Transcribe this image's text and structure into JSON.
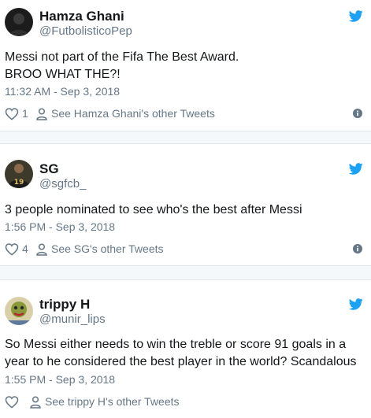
{
  "colors": {
    "twitter_blue": "#1da1f2",
    "muted": "#657786",
    "text": "#14171a",
    "divider": "#e1e8ed"
  },
  "tweets": [
    {
      "name": "Hamza Ghani",
      "handle": "@FutbolisticoPep",
      "text_lines": [
        "Messi not part of the Fifa The Best Award.",
        "BROO WHAT THE?!"
      ],
      "time": "11:32 AM - Sep 3, 2018",
      "likes": "1",
      "other_tweets": "See Hamza Ghani's other Tweets",
      "icons": {
        "like": "heart-icon",
        "profile": "person-icon",
        "info": "info-icon",
        "brand": "twitter-bird-icon"
      }
    },
    {
      "name": "SG",
      "handle": "@sgfcb_",
      "text_lines": [
        "3 people nominated to see who's the best after Messi"
      ],
      "time": "1:56 PM - Sep 3, 2018",
      "likes": "4",
      "other_tweets": "See SG's other Tweets",
      "icons": {
        "like": "heart-icon",
        "profile": "person-icon",
        "info": "info-icon",
        "brand": "twitter-bird-icon"
      }
    },
    {
      "name": "trippy H",
      "handle": "@munir_lips",
      "text_lines": [
        "So Messi either needs to win the treble or score 91 goals in a",
        "year to he considered the best player in the world? Scandalous"
      ],
      "time": "1:55 PM - Sep 3, 2018",
      "likes": "",
      "other_tweets": "See trippy H's other Tweets",
      "icons": {
        "like": "heart-icon",
        "profile": "person-icon",
        "info": "info-icon",
        "brand": "twitter-bird-icon"
      }
    }
  ]
}
